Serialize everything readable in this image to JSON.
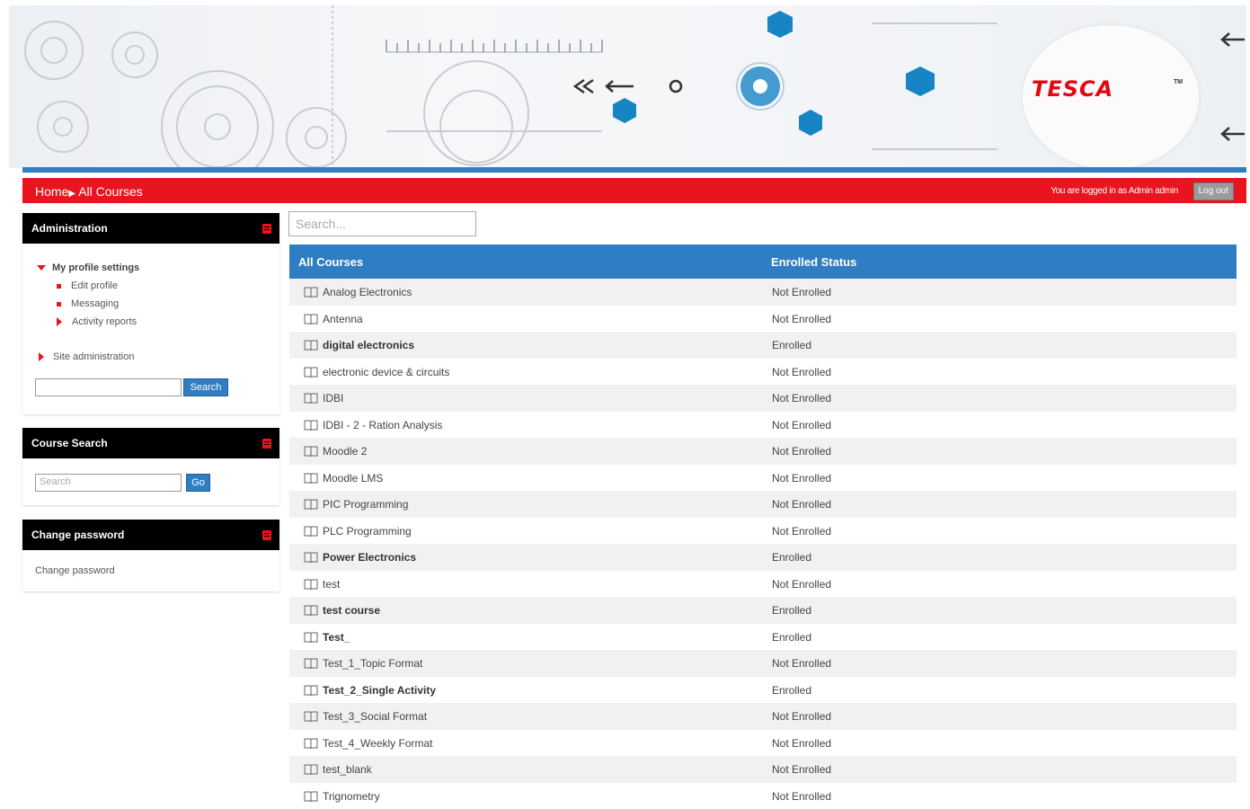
{
  "brand": {
    "name": "TESCA",
    "tm": "TM"
  },
  "nav": {
    "home": "Home",
    "separator": "▶",
    "current": "All Courses",
    "login_text": "You are logged in as Admin admin",
    "logout_label": "Log out"
  },
  "admin_block": {
    "title": "Administration",
    "profile_settings": "My profile settings",
    "edit_profile": "Edit profile",
    "messaging": "Messaging",
    "activity_reports": "Activity reports",
    "site_admin": "Site administration",
    "search_button": "Search"
  },
  "course_search_block": {
    "title": "Course Search",
    "placeholder": "Search",
    "go_button": "Go"
  },
  "change_password_block": {
    "title": "Change password",
    "link": "Change password"
  },
  "main_search": {
    "placeholder": "Search..."
  },
  "courses_table": {
    "header_course": "All Courses",
    "header_status": "Enrolled Status",
    "rows": [
      {
        "name": "Analog Electronics",
        "status": "Not Enrolled"
      },
      {
        "name": "Antenna",
        "status": "Not Enrolled"
      },
      {
        "name": "digital electronics",
        "status": "Enrolled"
      },
      {
        "name": "electronic device & circuits",
        "status": "Not Enrolled"
      },
      {
        "name": "IDBI",
        "status": "Not Enrolled"
      },
      {
        "name": "IDBI - 2 - Ration Analysis",
        "status": "Not Enrolled"
      },
      {
        "name": "Moodle 2",
        "status": "Not Enrolled"
      },
      {
        "name": "Moodle LMS",
        "status": "Not Enrolled"
      },
      {
        "name": "PIC Programming",
        "status": "Not Enrolled"
      },
      {
        "name": "PLC Programming",
        "status": "Not Enrolled"
      },
      {
        "name": "Power Electronics",
        "status": "Enrolled"
      },
      {
        "name": "test",
        "status": "Not Enrolled"
      },
      {
        "name": "test course",
        "status": "Enrolled"
      },
      {
        "name": "Test_",
        "status": "Enrolled"
      },
      {
        "name": "Test_1_Topic Format",
        "status": "Not Enrolled"
      },
      {
        "name": "Test_2_Single Activity",
        "status": "Enrolled"
      },
      {
        "name": "Test_3_Social Format",
        "status": "Not Enrolled"
      },
      {
        "name": "Test_4_Weekly Format",
        "status": "Not Enrolled"
      },
      {
        "name": "test_blank",
        "status": "Not Enrolled"
      },
      {
        "name": "Trignometry",
        "status": "Not Enrolled"
      }
    ]
  },
  "colors": {
    "brand_red": "#e8141e",
    "brand_blue": "#2f7dc2"
  }
}
